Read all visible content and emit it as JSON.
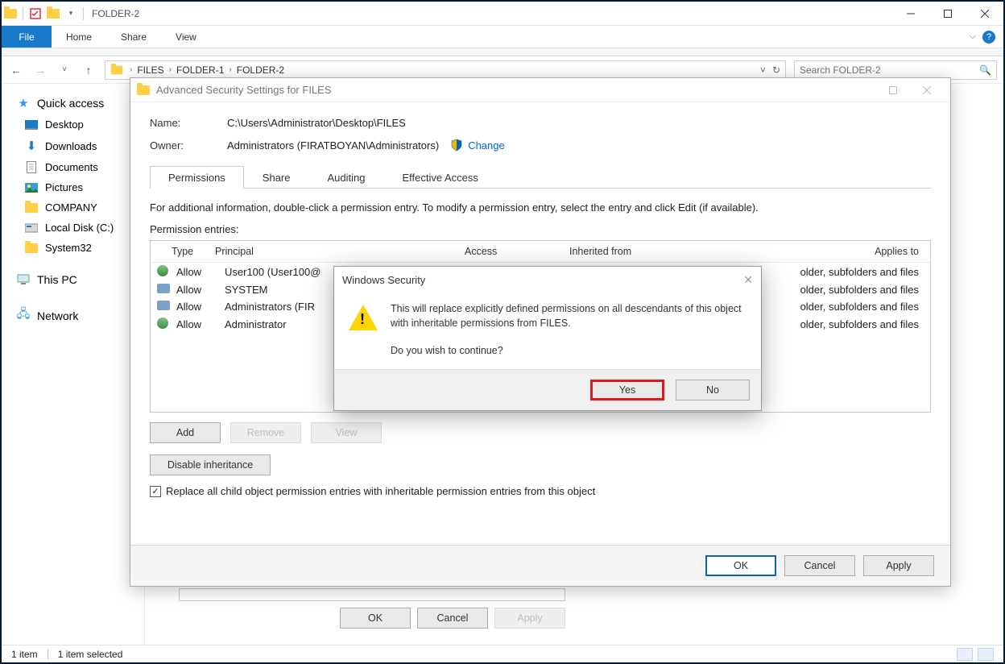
{
  "window": {
    "title": "FOLDER-2"
  },
  "ribbon": {
    "file": "File",
    "tabs": [
      "Home",
      "Share",
      "View"
    ]
  },
  "nav": {
    "crumbs": [
      "FILES",
      "FOLDER-1",
      "FOLDER-2"
    ],
    "search_placeholder": "Search FOLDER-2"
  },
  "sidebar": {
    "quick_access": "Quick access",
    "items": [
      "Desktop",
      "Downloads",
      "Documents",
      "Pictures",
      "COMPANY",
      "Local Disk (C:)",
      "System32"
    ],
    "this_pc": "This PC",
    "network": "Network"
  },
  "status": {
    "items": "1 item",
    "selected": "1 item selected"
  },
  "adv": {
    "title": "Advanced Security Settings for FILES",
    "name_label": "Name:",
    "name_value": "C:\\Users\\Administrator\\Desktop\\FILES",
    "owner_label": "Owner:",
    "owner_value": "Administrators (FIRATBOYAN\\Administrators)",
    "change": "Change",
    "tabs": [
      "Permissions",
      "Share",
      "Auditing",
      "Effective Access"
    ],
    "info": "For additional information, double-click a permission entry. To modify a permission entry, select the entry and click Edit (if available).",
    "entries_label": "Permission entries:",
    "cols": {
      "type": "Type",
      "principal": "Principal",
      "access": "Access",
      "inherited": "Inherited from",
      "applies": "Applies to"
    },
    "rows": [
      {
        "type": "Allow",
        "principal": "User100 (User100@",
        "applies": "older, subfolders and files",
        "kind": "user"
      },
      {
        "type": "Allow",
        "principal": "SYSTEM",
        "applies": "older, subfolders and files",
        "kind": "group"
      },
      {
        "type": "Allow",
        "principal": "Administrators (FIR",
        "applies": "older, subfolders and files",
        "kind": "group"
      },
      {
        "type": "Allow",
        "principal": "Administrator",
        "applies": "older, subfolders and files",
        "kind": "user"
      }
    ],
    "buttons": {
      "add": "Add",
      "remove": "Remove",
      "view": "View"
    },
    "disable": "Disable inheritance",
    "replace": "Replace all child object permission entries with inheritable permission entries from this object",
    "ok": "OK",
    "cancel": "Cancel",
    "apply": "Apply"
  },
  "bg_dlg": {
    "ok": "OK",
    "cancel": "Cancel",
    "apply": "Apply"
  },
  "modal": {
    "title": "Windows Security",
    "msg1": "This will replace explicitly defined permissions on all descendants of this object with inheritable permissions from FILES.",
    "msg2": "Do you wish to continue?",
    "yes": "Yes",
    "no": "No"
  }
}
